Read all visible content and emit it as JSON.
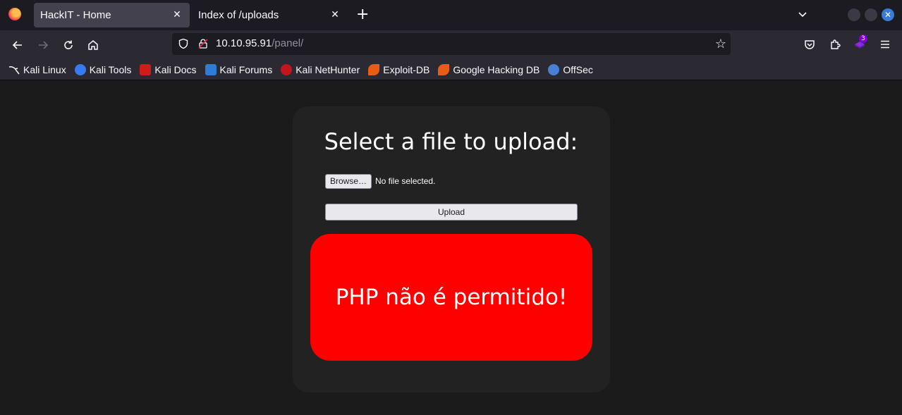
{
  "tabs": [
    {
      "title": "HackIT - Home",
      "active": true
    },
    {
      "title": "Index of /uploads",
      "active": false
    }
  ],
  "address": {
    "host": "10.10.95.91",
    "path": "/panel/"
  },
  "extensions_badge": "3",
  "bookmarks": [
    {
      "label": "Kali Linux",
      "icon": "kali-dragon-icon",
      "color": "#2a2a2a"
    },
    {
      "label": "Kali Tools",
      "icon": "kali-tools-icon",
      "color": "#367bf0"
    },
    {
      "label": "Kali Docs",
      "icon": "kali-docs-icon",
      "color": "#d11a1a"
    },
    {
      "label": "Kali Forums",
      "icon": "kali-forums-icon",
      "color": "#2f7bd8"
    },
    {
      "label": "Kali NetHunter",
      "icon": "nethunter-icon",
      "color": "#c3161c"
    },
    {
      "label": "Exploit-DB",
      "icon": "exploitdb-icon",
      "color": "#ea5b13"
    },
    {
      "label": "Google Hacking DB",
      "icon": "ghdb-icon",
      "color": "#ea5b13"
    },
    {
      "label": "OffSec",
      "icon": "offsec-icon",
      "color": "#4a7fd6"
    }
  ],
  "page": {
    "heading": "Select a file to upload:",
    "browse_label": "Browse…",
    "file_status": "No file selected.",
    "upload_label": "Upload",
    "alert_message": "PHP não é permitido!",
    "alert_color": "#ff0000"
  }
}
